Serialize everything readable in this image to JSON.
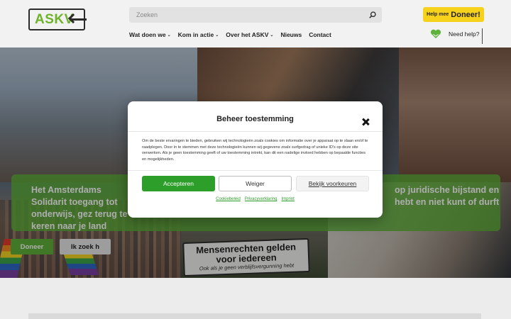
{
  "header": {
    "logo_text": "ASKV",
    "search_placeholder": "Zoeken",
    "donate_small": "Help mee",
    "donate_big": "Doneer!",
    "nav": [
      {
        "label": "Wat doen we",
        "chevron": "⌄"
      },
      {
        "label": "Kom in actie",
        "chevron": "⌄"
      },
      {
        "label": "Over het ASKV",
        "chevron": "⌄"
      },
      {
        "label": "Nieuws",
        "chevron": ""
      },
      {
        "label": "Contact",
        "chevron": ""
      }
    ],
    "help_label": "Need help?"
  },
  "hero": {
    "text_left": "Het Amsterdams Solidarit toegang tot onderwijs, gez terug te keren naar je land",
    "text_right": "op juridische bijstand en hebt en niet kunt of durft",
    "banner_line1": "Mensenrechten gelden",
    "banner_line2": "voor iedereen",
    "banner_line3": "Ook als je geen verblijfsvergunning hebt",
    "donate_button": "Doneer",
    "need_button": "Ik zoek h"
  },
  "consent": {
    "title": "Beheer toestemming",
    "body": "Om de beste ervaringen te bieden, gebruiken wij technologieën zoals cookies om informatie over je apparaat op te slaan en/of te raadplegen. Door in te stemmen met deze technologieën kunnen wij gegevens zoals surfgedrag of unieke ID's op deze site verwerken. Als je geen toestemming geeft of uw toestemming intrekt, kan dit een nadelige invloed hebben op bepaalde functies en mogelijkheden.",
    "accept_label": "Accepteren",
    "deny_label": "Weiger",
    "prefs_label": "Bekijk voorkeuren",
    "links": [
      "Cookiebeleid",
      "Privacyverklaring",
      "Imprint"
    ]
  },
  "colors": {
    "brand_green": "#5fb23a",
    "accept_green": "#2d9e2a",
    "donate_yellow": "#f6d21c"
  },
  "icons": {
    "search": "search-icon",
    "heart": "heart-hands-icon",
    "close": "close-icon"
  }
}
